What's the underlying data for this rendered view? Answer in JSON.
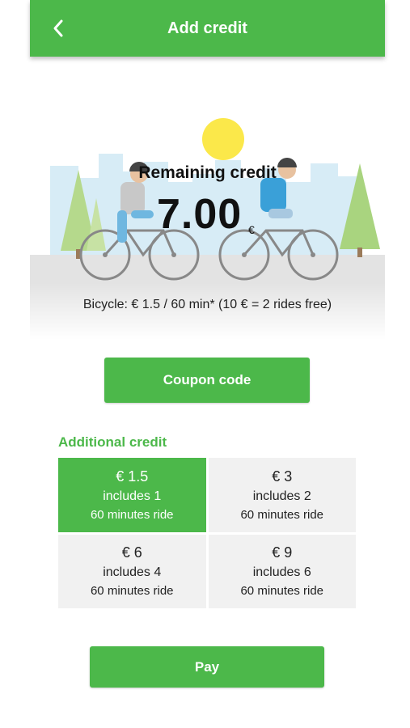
{
  "header": {
    "title": "Add credit",
    "back_icon": "chevron-left-icon"
  },
  "hero": {
    "remaining_label": "Remaining credit",
    "credit_amount": "7.00",
    "credit_currency": "€",
    "pricing_info": "Bicycle: € 1.5 / 60 min* (10 € = 2 rides free)"
  },
  "coupon_button": "Coupon code",
  "additional_credit": {
    "title": "Additional credit",
    "options": [
      {
        "price": "€ 1.5",
        "includes": "includes 1",
        "duration": "60 minutes ride",
        "selected": true
      },
      {
        "price": "€ 3",
        "includes": "includes 2",
        "duration": "60 minutes ride",
        "selected": false
      },
      {
        "price": "€ 6",
        "includes": "includes 4",
        "duration": "60 minutes ride",
        "selected": false
      },
      {
        "price": "€ 9",
        "includes": "includes 6",
        "duration": "60 minutes ride",
        "selected": false
      }
    ]
  },
  "pay_button": "Pay",
  "colors": {
    "accent": "#4cb84a",
    "tile_bg": "#f1f1f1",
    "sun": "#fbe84a"
  }
}
